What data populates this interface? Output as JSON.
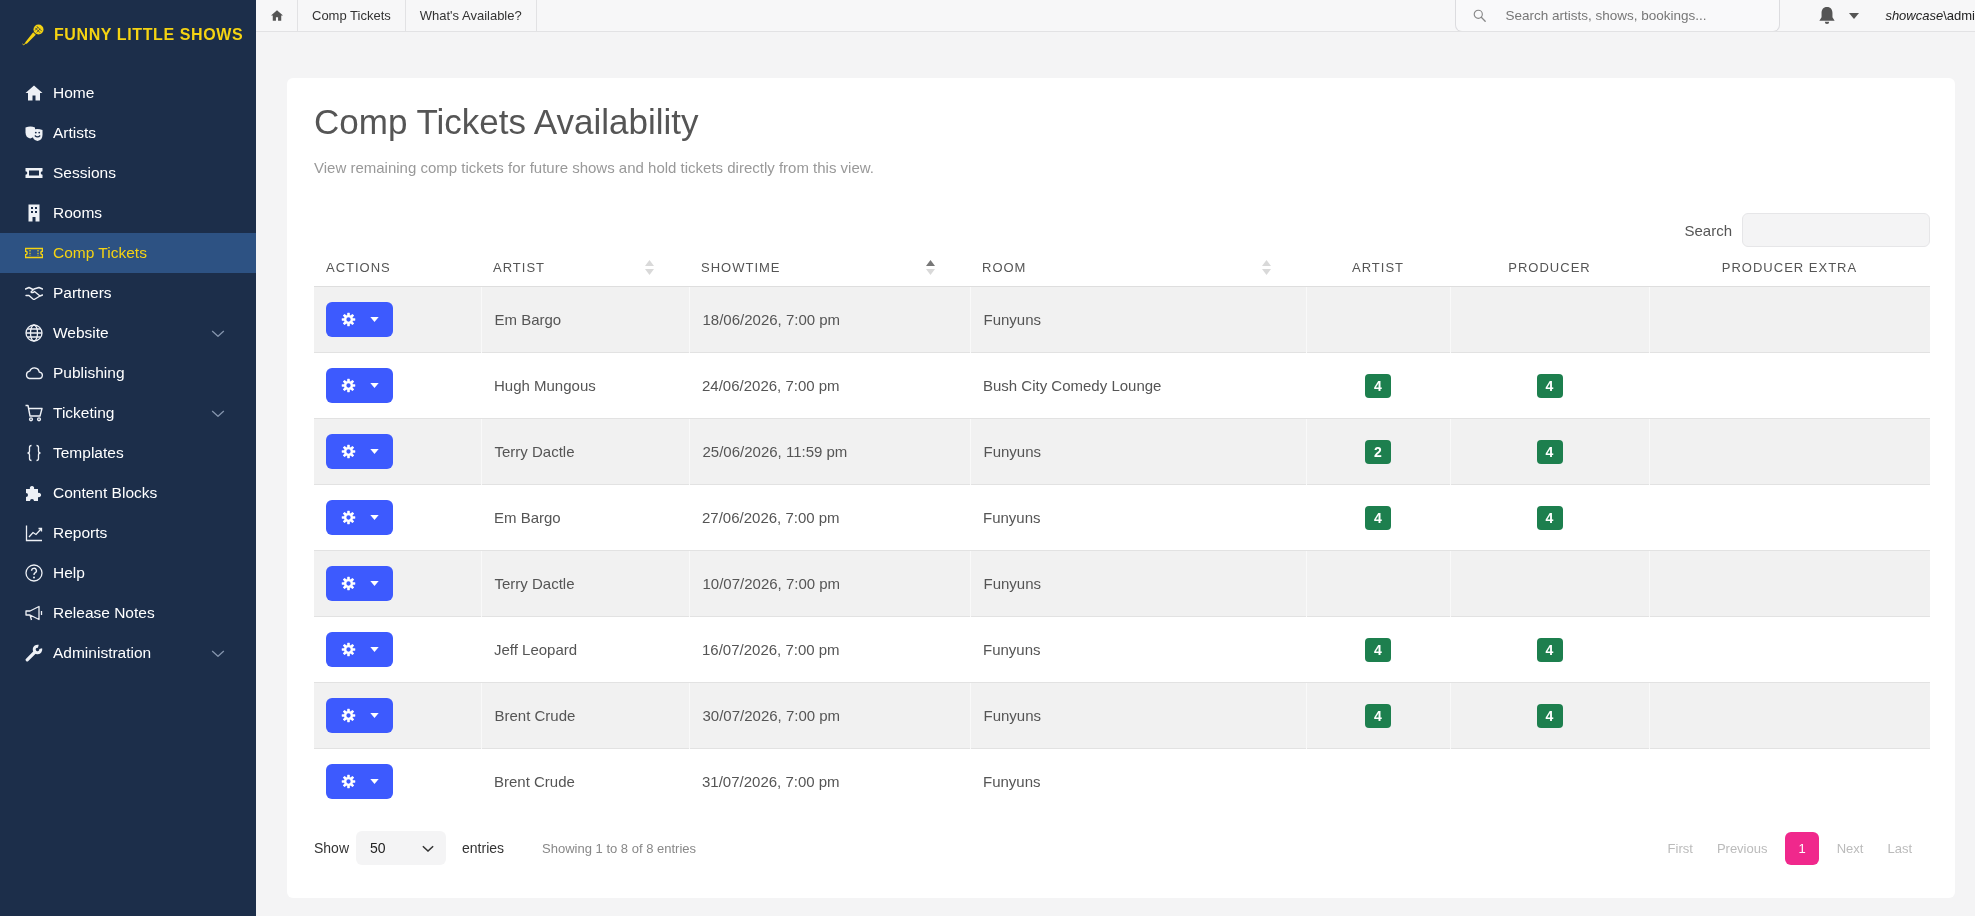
{
  "sidebar": {
    "logo": "FUNNY LITTLE SHOWS",
    "items": [
      {
        "label": "Home",
        "kind": "link",
        "selected": false
      },
      {
        "label": "Artists",
        "kind": "link",
        "selected": false
      },
      {
        "label": "Sessions",
        "kind": "link",
        "selected": false
      },
      {
        "label": "Rooms",
        "kind": "link",
        "selected": false
      },
      {
        "label": "Comp Tickets",
        "kind": "link",
        "selected": true
      },
      {
        "label": "Partners",
        "kind": "link",
        "selected": false
      },
      {
        "label": "Website",
        "kind": "group",
        "selected": false
      },
      {
        "label": "Publishing",
        "kind": "link",
        "selected": false
      },
      {
        "label": "Ticketing",
        "kind": "group",
        "selected": false
      },
      {
        "label": "Templates",
        "kind": "link",
        "selected": false
      },
      {
        "label": "Content Blocks",
        "kind": "link",
        "selected": false
      },
      {
        "label": "Reports",
        "kind": "link",
        "selected": false
      },
      {
        "label": "Help",
        "kind": "link",
        "selected": false
      },
      {
        "label": "Release Notes",
        "kind": "link",
        "selected": false
      },
      {
        "label": "Administration",
        "kind": "group",
        "selected": false
      }
    ]
  },
  "topbar": {
    "breadcrumbs": [
      "Comp Tickets",
      "What's Available?"
    ],
    "search": {
      "placeholder": "Search artists, shows, bookings..."
    },
    "user": "*showcase*\\admi"
  },
  "card": {
    "title": "Comp Tickets Availability",
    "subtitle": "View remaining comp tickets for future shows and hold tickets directly from this view.",
    "search": {
      "label": "Search"
    },
    "table": {
      "columns": [
        {
          "label": "ACTIONS",
          "sortable": false,
          "sorted": false
        },
        {
          "label": "ARTIST",
          "sortable": true,
          "sorted": false
        },
        {
          "label": "SHOWTIME",
          "sortable": true,
          "sorted": true
        },
        {
          "label": "ROOM",
          "sortable": true,
          "sorted": false
        },
        {
          "label": "ARTIST",
          "sortable": false,
          "sorted": false
        },
        {
          "label": "PRODUCER",
          "sortable": false,
          "sorted": false
        },
        {
          "label": "PRODUCER EXTRA",
          "sortable": false,
          "sorted": false
        }
      ],
      "rows": [
        {
          "artist": "Em Bargo",
          "showtime": "18/06/2026, 7:00 pm",
          "room": "Funyuns"
        },
        {
          "artist": "Hugh Mungous",
          "showtime": "24/06/2026, 7:00 pm",
          "room": "Bush City Comedy Lounge",
          "artist_tickets": "4",
          "producer_tickets": "4"
        },
        {
          "artist": "Terry Dactle",
          "showtime": "25/06/2026, 11:59 pm",
          "room": "Funyuns",
          "artist_tickets": "2",
          "producer_tickets": "4"
        },
        {
          "artist": "Em Bargo",
          "showtime": "27/06/2026, 7:00 pm",
          "room": "Funyuns",
          "artist_tickets": "4",
          "producer_tickets": "4"
        },
        {
          "artist": "Terry Dactle",
          "showtime": "10/07/2026, 7:00 pm",
          "room": "Funyuns"
        },
        {
          "artist": "Jeff Leopard",
          "showtime": "16/07/2026, 7:00 pm",
          "room": "Funyuns",
          "artist_tickets": "4",
          "producer_tickets": "4"
        },
        {
          "artist": "Brent Crude",
          "showtime": "30/07/2026, 7:00 pm",
          "room": "Funyuns",
          "artist_tickets": "4",
          "producer_tickets": "4"
        },
        {
          "artist": "Brent Crude",
          "showtime": "31/07/2026, 7:00 pm",
          "room": "Funyuns"
        }
      ]
    },
    "footer": {
      "show_label": "Show",
      "page_length": "50",
      "entries_label": "entries",
      "info": "Showing 1 to 8 of 8 entries",
      "pagination": [
        {
          "label": "First",
          "selected": false,
          "disabled": true
        },
        {
          "label": "Previous",
          "selected": false,
          "disabled": true
        },
        {
          "label": "1",
          "selected": true,
          "disabled": false
        },
        {
          "label": "Next",
          "selected": false,
          "disabled": true
        },
        {
          "label": "Last",
          "selected": false,
          "disabled": true
        }
      ]
    }
  }
}
